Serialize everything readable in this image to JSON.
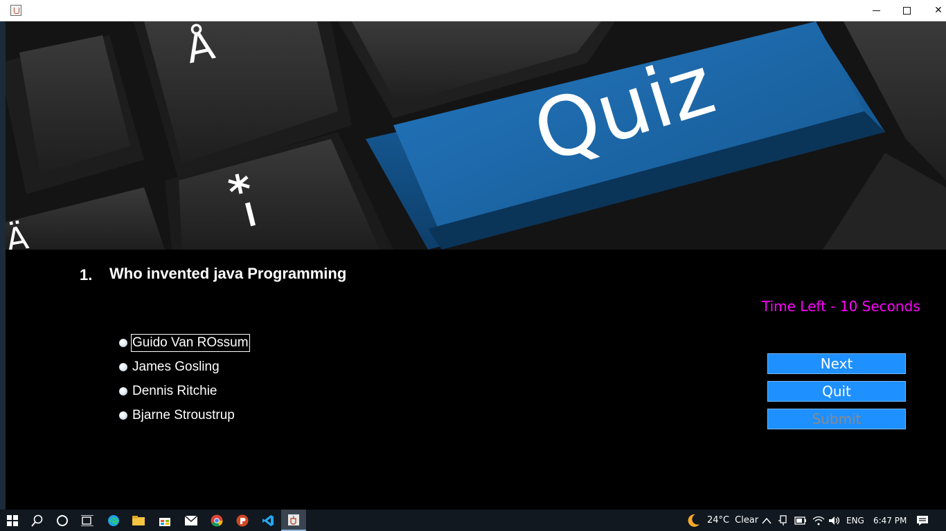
{
  "window": {
    "controls": {
      "minimize": "minimize",
      "maximize": "maximize",
      "close": "✕"
    }
  },
  "banner": {
    "key_text": "Quiz",
    "key_glyph_top": "Å",
    "key_glyph_mid": "*",
    "key_glyph_low": "/",
    "key_glyph_left": "Ä"
  },
  "question": {
    "number": "1.",
    "text": "Who invented java Programming"
  },
  "timer": "Time Left - 10 Seconds",
  "options": [
    {
      "label": "Guido Van ROssum",
      "focused": true
    },
    {
      "label": "James Gosling",
      "focused": false
    },
    {
      "label": "Dennis Ritchie",
      "focused": false
    },
    {
      "label": "Bjarne Stroustrup",
      "focused": false
    }
  ],
  "buttons": {
    "next": "Next",
    "quit": "Quit",
    "submit": "Submit"
  },
  "taskbar": {
    "weather_temp": "24°C",
    "weather_text": "Clear",
    "language": "ENG",
    "time": "6:47 PM"
  },
  "colors": {
    "accent_button": "#1e90ff",
    "timer": "#ff00ff",
    "quiz_key": "#1a5fa0"
  }
}
